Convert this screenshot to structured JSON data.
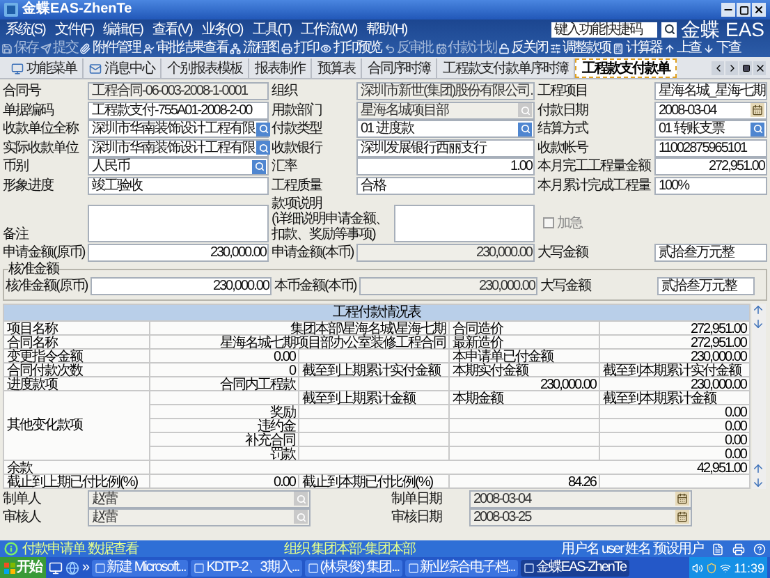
{
  "window": {
    "title": "金蝶EAS-ZhenTe"
  },
  "menu": [
    "系统(S)",
    "文件(F)",
    "编辑(E)",
    "查看(V)",
    "业务(O)",
    "工具(T)",
    "工作流(W)",
    "帮助(H)"
  ],
  "quick_search": {
    "placeholder": "键入功能快捷码"
  },
  "logo": "金蝶 EAS",
  "toolbar": [
    {
      "label": "保存",
      "disabled": true
    },
    {
      "label": "提交",
      "disabled": true
    },
    {
      "label": "附件管理",
      "disabled": false
    },
    {
      "label": "审批结果查看",
      "disabled": false
    },
    {
      "label": "流程图",
      "disabled": false
    },
    {
      "label": "打印",
      "disabled": false
    },
    {
      "label": "打印预览",
      "disabled": false
    },
    {
      "label": "反审批",
      "disabled": true
    },
    {
      "label": "付款计划",
      "disabled": true
    },
    {
      "label": "反关闭",
      "disabled": false
    },
    {
      "label": "调整款项",
      "disabled": false
    },
    {
      "label": "计算器",
      "disabled": false
    },
    {
      "label": "上查",
      "disabled": false
    },
    {
      "label": "下查",
      "disabled": false
    }
  ],
  "tabs": [
    {
      "label": "功能菜单",
      "selected": false
    },
    {
      "label": "消息中心",
      "selected": false
    },
    {
      "label": "个别报表模板",
      "selected": false
    },
    {
      "label": "报表制作",
      "selected": false
    },
    {
      "label": "预算表",
      "selected": false
    },
    {
      "label": "合同序时簿",
      "selected": false
    },
    {
      "label": "工程款支付款单序时簿",
      "selected": false
    },
    {
      "label": "工程款支付款单",
      "selected": true
    }
  ],
  "form": {
    "rows": [
      [
        {
          "label": "合同号",
          "value": "工程合同-06-003-2008-1-0001",
          "kind": "text",
          "disabled": true
        },
        {
          "label": "组织",
          "value": "深圳市新世(集团)股份有限公司.",
          "kind": "text",
          "disabled": true
        },
        {
          "label": "工程项目",
          "value": "星海名城_星海七期",
          "kind": "text",
          "disabled": false
        }
      ],
      [
        {
          "label": "单据编码",
          "value": "工程款支付-755A01-2008-2-00",
          "kind": "text",
          "disabled": false
        },
        {
          "label": "用款部门",
          "value": "星海名城项目部",
          "kind": "lookup",
          "disabled": true
        },
        {
          "label": "付款日期",
          "value": "2008-03-04",
          "kind": "date",
          "disabled": false
        }
      ],
      [
        {
          "label": "收款单位全称",
          "value": "深圳市华南装饰设计工程有限",
          "kind": "lookup",
          "disabled": false
        },
        {
          "label": "付款类型",
          "value": "01 进度款",
          "kind": "lookup",
          "disabled": false
        },
        {
          "label": "结算方式",
          "value": "01 转账支票",
          "kind": "lookup",
          "disabled": false
        }
      ],
      [
        {
          "label": "实际收款单位",
          "value": "深圳市华南装饰设计工程有限",
          "kind": "lookup",
          "disabled": false
        },
        {
          "label": "收款银行",
          "value": "深圳发展银行西丽支行",
          "kind": "text",
          "disabled": false
        },
        {
          "label": "收款帐号",
          "value": "11002875965101",
          "kind": "text",
          "disabled": false
        }
      ],
      [
        {
          "label": "币别",
          "value": "人民币",
          "kind": "lookup",
          "disabled": false
        },
        {
          "label": "汇率",
          "value": "1.00",
          "kind": "amount",
          "disabled": false
        },
        {
          "label": "本月完工工程量金额",
          "value": "272,951.00",
          "kind": "amount",
          "disabled": false
        }
      ],
      [
        {
          "label": "形象进度",
          "value": "竣工验收",
          "kind": "text",
          "disabled": false
        },
        {
          "label": "工程质量",
          "value": "合格",
          "kind": "text",
          "disabled": false
        },
        {
          "label": "本月累计完成工程量",
          "value": "100%",
          "kind": "text",
          "disabled": false
        }
      ]
    ],
    "remark": {
      "label": "备注"
    },
    "description": {
      "label": [
        "款项说明",
        "(详细说明申请金额、",
        "扣款、奖励等事项)"
      ]
    },
    "urgent": {
      "label": "加急",
      "checked": false
    },
    "applied": [
      {
        "label": "申请金额(原币)",
        "value": "230,000.00",
        "kind": "amount",
        "disabled": false
      },
      {
        "label": "申请金额(本币)",
        "value": "230,000.00",
        "kind": "amount",
        "disabled": true
      },
      {
        "label": "大写金额",
        "value": "贰拾叁万元整",
        "kind": "text",
        "disabled": false
      }
    ],
    "approved": {
      "legend": "核准金额",
      "fields": [
        {
          "label": "核准金额(原币)",
          "value": "230,000.00",
          "kind": "amount",
          "disabled": false
        },
        {
          "label": "本币金额(本币)",
          "value": "230,000.00",
          "kind": "amount",
          "disabled": true
        },
        {
          "label": "大写金额",
          "value": "贰拾叁万元整",
          "kind": "text",
          "disabled": false
        }
      ]
    }
  },
  "payment_table": {
    "title": "工程付款情况表",
    "rows": [
      {
        "kind": "plain",
        "cells": [
          {
            "kind": "label",
            "text": "项目名称"
          },
          {
            "kind": "wide-value",
            "text": "集团本部\\星海名城\\星海七期"
          },
          {
            "kind": "label",
            "text": "合同造价"
          },
          {
            "kind": "value",
            "text": "272,951.00"
          }
        ]
      },
      {
        "kind": "plain",
        "cells": [
          {
            "kind": "label",
            "text": "合同名称"
          },
          {
            "kind": "wide-value",
            "text": "星海名城七期项目部办公室装修工程合同"
          },
          {
            "kind": "label",
            "text": "最新造价"
          },
          {
            "kind": "value",
            "text": "272,951.00"
          }
        ]
      },
      {
        "kind": "plain",
        "cells": [
          {
            "kind": "label",
            "text": "变更指令金额"
          },
          {
            "kind": "value",
            "text": "0.00"
          },
          {
            "kind": "blank"
          },
          {
            "kind": "label",
            "text": "本申请单已付金额"
          },
          {
            "kind": "value",
            "text": "230,000.00"
          }
        ]
      },
      {
        "kind": "plain",
        "cells": [
          {
            "kind": "label",
            "text": "合同付款次数"
          },
          {
            "kind": "value",
            "text": "0"
          },
          {
            "kind": "label",
            "text": "截至到上期累计实付金额"
          },
          {
            "kind": "label",
            "text": "本期实付金额"
          },
          {
            "kind": "label",
            "text": "截至到本期累计实付金额"
          }
        ]
      },
      {
        "kind": "plain",
        "cells": [
          {
            "kind": "label",
            "text": "进度款项"
          },
          {
            "kind": "value",
            "text": "合同内工程款"
          },
          {
            "kind": "blank"
          },
          {
            "kind": "value",
            "text": "230,000.00"
          },
          {
            "kind": "value",
            "text": "230,000.00"
          }
        ]
      },
      {
        "kind": "group",
        "label": "其他变化款项",
        "rows": [
          {
            "cells": [
              {
                "kind": "blank"
              },
              {
                "kind": "label",
                "text": "截至到上期累计金额"
              },
              {
                "kind": "label",
                "text": "本期金额"
              },
              {
                "kind": "label",
                "text": "截至到本期累计金额"
              }
            ]
          },
          {
            "cells": [
              {
                "kind": "value",
                "text": "奖励"
              },
              {
                "kind": "blank"
              },
              {
                "kind": "blank"
              },
              {
                "kind": "value",
                "text": "0.00"
              }
            ]
          },
          {
            "cells": [
              {
                "kind": "value",
                "text": "违约金"
              },
              {
                "kind": "blank"
              },
              {
                "kind": "blank"
              },
              {
                "kind": "value",
                "text": "0.00"
              }
            ]
          },
          {
            "cells": [
              {
                "kind": "value",
                "text": "补充合同"
              },
              {
                "kind": "blank"
              },
              {
                "kind": "blank"
              },
              {
                "kind": "value",
                "text": "0.00"
              }
            ]
          },
          {
            "cells": [
              {
                "kind": "value",
                "text": "罚款"
              },
              {
                "kind": "blank"
              },
              {
                "kind": "blank"
              },
              {
                "kind": "value",
                "text": "0.00"
              }
            ]
          }
        ]
      },
      {
        "kind": "plain",
        "cells": [
          {
            "kind": "label",
            "text": "余款"
          },
          {
            "kind": "full-value",
            "text": "42,951.00"
          }
        ]
      },
      {
        "kind": "plain",
        "cells": [
          {
            "kind": "label",
            "text": "截止到上期已付比例(%)"
          },
          {
            "kind": "value",
            "text": "0.00"
          },
          {
            "kind": "label",
            "text": "截止到本期已付比例(%)"
          },
          {
            "kind": "value",
            "text": "84.26"
          },
          {
            "kind": "blank"
          }
        ]
      }
    ]
  },
  "footer": [
    [
      {
        "label": "制单人",
        "value": "赵蕾",
        "kind": "lookup",
        "disabled": true
      },
      {
        "label": "制单日期",
        "value": "2008-03-04",
        "kind": "date",
        "disabled": true
      }
    ],
    [
      {
        "label": "审核人",
        "value": "赵蕾",
        "kind": "lookup",
        "disabled": true
      },
      {
        "label": "审核日期",
        "value": "2008-03-25",
        "kind": "date",
        "disabled": true
      }
    ]
  ],
  "status_bar": {
    "message": "付款申请单 数据查看",
    "organization": "组织 集团本部-集团本部",
    "user": "用户名 user 姓名 预设用户"
  },
  "taskbar": {
    "start": "开始",
    "overflow": "»",
    "buttons": [
      {
        "label": "新建 Microsoft...",
        "selected": false
      },
      {
        "label": "KDTP-2、3期入...",
        "selected": false
      },
      {
        "label": "(林泉俊) 集团...",
        "selected": false
      },
      {
        "label": "新业综合电子档...",
        "selected": false
      },
      {
        "label": "金蝶EAS-ZhenTe",
        "selected": true
      }
    ],
    "clock": "11:39"
  }
}
